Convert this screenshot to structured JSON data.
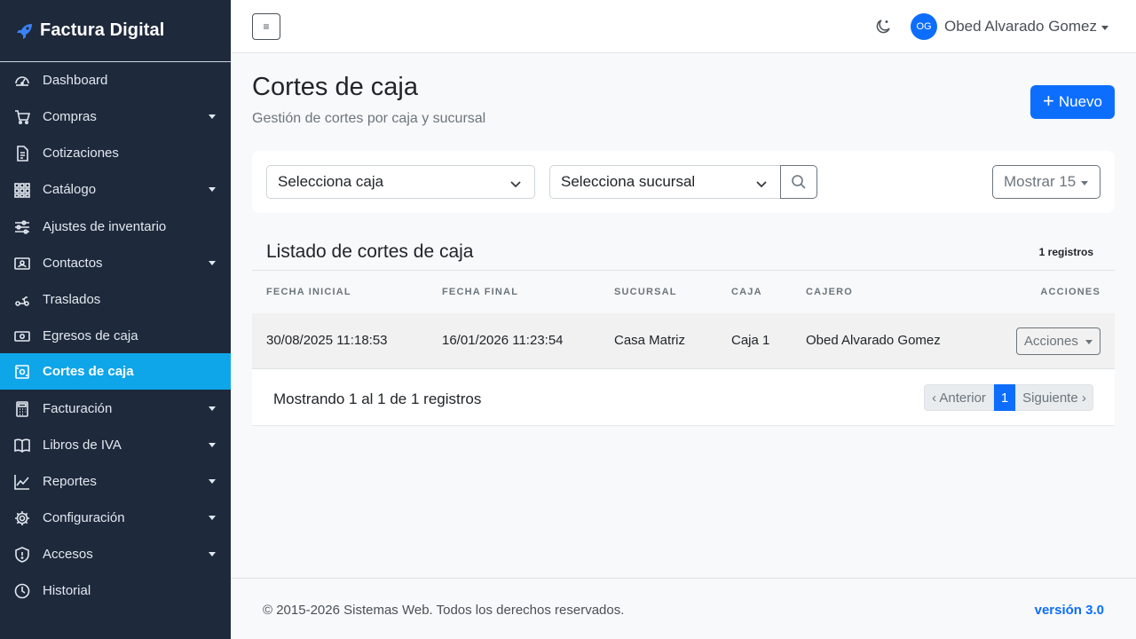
{
  "brand": {
    "name": "Factura Digital"
  },
  "sidebar": {
    "items": [
      {
        "label": "Dashboard",
        "icon": "dashboard-icon"
      },
      {
        "label": "Compras",
        "icon": "cart-icon"
      },
      {
        "label": "Cotizaciones",
        "icon": "document-icon"
      },
      {
        "label": "Catálogo",
        "icon": "grid-icon"
      },
      {
        "label": "Ajustes de inventario",
        "icon": "sliders-icon"
      },
      {
        "label": "Contactos",
        "icon": "contact-card-icon"
      },
      {
        "label": "Traslados",
        "icon": "scooter-icon"
      },
      {
        "label": "Egresos de caja",
        "icon": "cash-icon"
      },
      {
        "label": "Cortes de caja",
        "icon": "cash-register-icon",
        "active": true
      },
      {
        "label": "Facturación",
        "icon": "calculator-icon"
      },
      {
        "label": "Libros de IVA",
        "icon": "book-icon"
      },
      {
        "label": "Reportes",
        "icon": "chart-line-icon"
      },
      {
        "label": "Configuración",
        "icon": "gear-icon"
      },
      {
        "label": "Accesos",
        "icon": "shield-icon"
      },
      {
        "label": "Historial",
        "icon": "clock-icon"
      }
    ]
  },
  "topbar": {
    "toggle_glyph": "≡",
    "theme_icon": "moon-stars-icon",
    "user": {
      "initials": "OG",
      "name": "Obed Alvarado Gomez"
    }
  },
  "page": {
    "title": "Cortes de caja",
    "subtitle": "Gestión de cortes por caja y sucursal",
    "new_button": "Nuevo",
    "new_button_icon": "+"
  },
  "filters": {
    "caja_select": "Selecciona caja",
    "sucursal_select": "Selecciona sucursal",
    "show_select": "Mostrar 15"
  },
  "table": {
    "title": "Listado de cortes de caja",
    "count": "1 registros",
    "headers": [
      "FECHA INICIAL",
      "FECHA FINAL",
      "SUCURSAL",
      "CAJA",
      "CAJERO",
      "ACCIONES"
    ],
    "rows": [
      {
        "fecha_inicial": "30/08/2025 11:18:53",
        "fecha_final": "16/01/2026 11:23:54",
        "sucursal": "Casa Matriz",
        "caja": "Caja 1",
        "cajero": "Obed Alvarado Gomez",
        "acciones": "Acciones"
      }
    ],
    "footer_text": "Mostrando 1 al 1 de 1 registros",
    "pagination": {
      "prev": "‹ Anterior",
      "current": "1",
      "next": "Siguiente ›"
    }
  },
  "footer": {
    "copyright": "© 2015-2026 Sistemas Web. Todos los derechos reservados.",
    "version": "versión 3.0"
  },
  "colors": {
    "sidebar_bg": "#1e293b",
    "active_item": "#0ea5e9",
    "primary": "#0d6efd"
  }
}
